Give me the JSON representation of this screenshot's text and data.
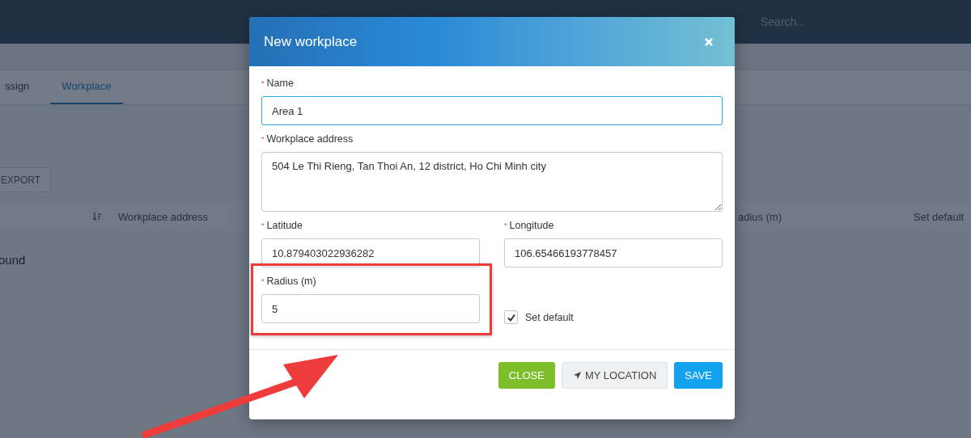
{
  "background": {
    "search": {
      "placeholder": "Search..."
    },
    "tabs": [
      {
        "label": "ssign",
        "selected": false
      },
      {
        "label": "Workplace",
        "selected": true
      }
    ],
    "export_button": "EXPORT",
    "table": {
      "columns": [
        "Workplace address",
        "adius (m)",
        "Set default"
      ],
      "empty_text": "ound"
    }
  },
  "dialog": {
    "title": "New workplace",
    "fields": [
      {
        "label": "Name",
        "marker": "*",
        "value": "Area 1",
        "kind": "input",
        "wide": true,
        "focused": true,
        "highlighted": false
      },
      {
        "label": "Workplace address",
        "marker": "*",
        "value": "504 Le Thi Rieng, Tan Thoi An, 12 district, Ho Chi Minh city",
        "kind": "textarea",
        "wide": true,
        "focused": false,
        "highlighted": false
      },
      {
        "label": "Latitude",
        "marker": "*",
        "value": "10.879403022936282",
        "kind": "input",
        "wide": false,
        "focused": false,
        "highlighted": false
      },
      {
        "label": "Longitude",
        "marker": "*",
        "value": "106.65466193778457",
        "kind": "input",
        "wide": false,
        "focused": false,
        "highlighted": false
      },
      {
        "label": "Radius (m)",
        "marker": "*",
        "value": "5",
        "kind": "input",
        "wide": false,
        "focused": false,
        "highlighted": true
      }
    ],
    "set_default": {
      "label": "Set default",
      "checked": true
    },
    "buttons": [
      {
        "label": "CLOSE",
        "kind": "close"
      },
      {
        "label": "MY LOCATION",
        "kind": "location"
      },
      {
        "label": "SAVE",
        "kind": "save"
      }
    ]
  }
}
